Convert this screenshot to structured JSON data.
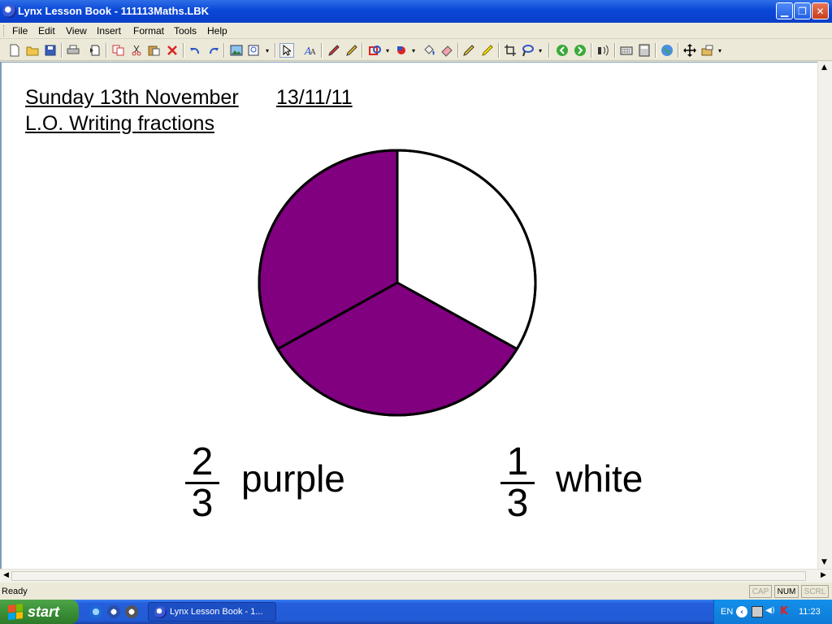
{
  "window": {
    "title": "Lynx Lesson Book - 111113Maths.LBK",
    "min_glyph": "▁",
    "restore_glyph": "❐",
    "close_glyph": "✕"
  },
  "menu": [
    "File",
    "Edit",
    "View",
    "Insert",
    "Format",
    "Tools",
    "Help"
  ],
  "toolbar_icons": [
    "new-icon",
    "open-icon",
    "save-icon",
    "print-icon",
    "page-icon",
    "copy-icon",
    "cut-icon",
    "paste-icon",
    "delete-icon",
    "undo-icon",
    "redo-icon",
    "image-icon",
    "zoom-icon",
    "pointer-icon",
    "text-icon",
    "pen-icon",
    "pencil-icon",
    "shape-icon",
    "fill-color-icon",
    "fill-bucket-icon",
    "eraser-icon",
    "highlighter-icon",
    "marker-icon",
    "crop-icon",
    "lasso-icon",
    "back-icon",
    "forward-icon",
    "speak-icon",
    "keyboard-icon",
    "calculator-icon",
    "globe-icon",
    "move-icon",
    "tools-icon"
  ],
  "document": {
    "date_text": "Sunday 13th November",
    "date_short": "13/11/11",
    "objective": "L.O. Writing fractions"
  },
  "chart_data": {
    "type": "pie",
    "slices": [
      {
        "label": "purple",
        "value": 2,
        "color": "#800080"
      },
      {
        "label": "white",
        "value": 1,
        "color": "#ffffff"
      }
    ],
    "total_parts": 3
  },
  "fractions": [
    {
      "numerator": "2",
      "denominator": "3",
      "label": "purple"
    },
    {
      "numerator": "1",
      "denominator": "3",
      "label": "white"
    }
  ],
  "status": {
    "text": "Ready",
    "indicators": [
      {
        "label": "CAP",
        "active": false
      },
      {
        "label": "NUM",
        "active": true
      },
      {
        "label": "SCRL",
        "active": false
      }
    ]
  },
  "taskbar": {
    "start_label": "start",
    "task_label": "Lynx Lesson Book - 1...",
    "language": "EN",
    "clock": "11:23"
  }
}
